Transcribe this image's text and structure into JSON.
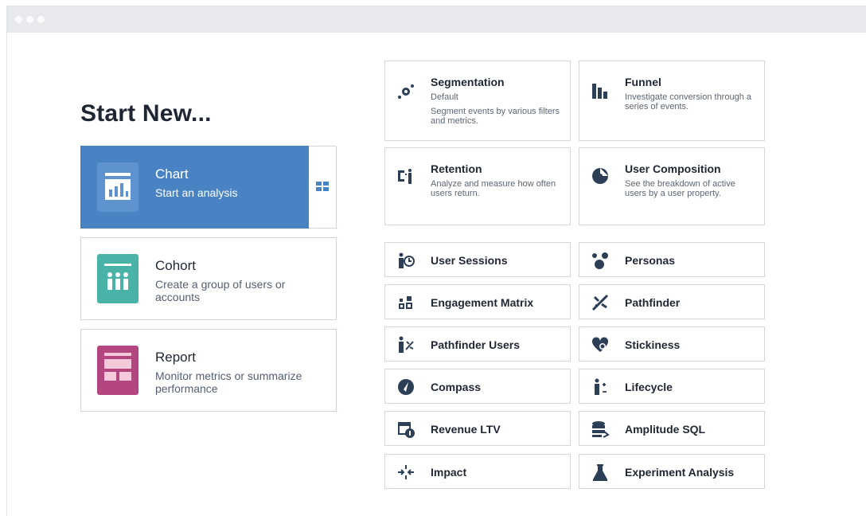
{
  "heading": "Start New...",
  "left_cards": [
    {
      "title": "Chart",
      "desc": "Start an analysis"
    },
    {
      "title": "Cohort",
      "desc": "Create a group of users or accounts"
    },
    {
      "title": "Report",
      "desc": "Monitor metrics or summarize performance"
    }
  ],
  "large_tiles": [
    {
      "title": "Segmentation",
      "subtitle": "Default",
      "desc": "Segment events by various filters and metrics.",
      "icon": "segmentation-icon"
    },
    {
      "title": "Funnel",
      "desc": "Investigate conversion through a series of events.",
      "icon": "funnel-icon"
    },
    {
      "title": "Retention",
      "desc": "Analyze and measure how often users return.",
      "icon": "retention-icon"
    },
    {
      "title": "User Composition",
      "desc": "See the breakdown of active users by a user property.",
      "icon": "user-composition-icon"
    }
  ],
  "small_tiles": [
    {
      "title": "User Sessions",
      "icon": "user-sessions-icon"
    },
    {
      "title": "Personas",
      "icon": "personas-icon"
    },
    {
      "title": "Engagement Matrix",
      "icon": "engagement-matrix-icon"
    },
    {
      "title": "Pathfinder",
      "icon": "pathfinder-icon"
    },
    {
      "title": "Pathfinder Users",
      "icon": "pathfinder-users-icon"
    },
    {
      "title": "Stickiness",
      "icon": "stickiness-icon"
    },
    {
      "title": "Compass",
      "icon": "compass-icon"
    },
    {
      "title": "Lifecycle",
      "icon": "lifecycle-icon"
    },
    {
      "title": "Revenue LTV",
      "icon": "revenue-ltv-icon"
    },
    {
      "title": "Amplitude SQL",
      "icon": "amplitude-sql-icon"
    },
    {
      "title": "Impact",
      "icon": "impact-icon"
    },
    {
      "title": "Experiment Analysis",
      "icon": "experiment-analysis-icon"
    }
  ],
  "colors": {
    "chart": "#4a83c4",
    "cohort": "#4ab3a8",
    "report": "#b3467f",
    "icon": "#2d3f57"
  }
}
